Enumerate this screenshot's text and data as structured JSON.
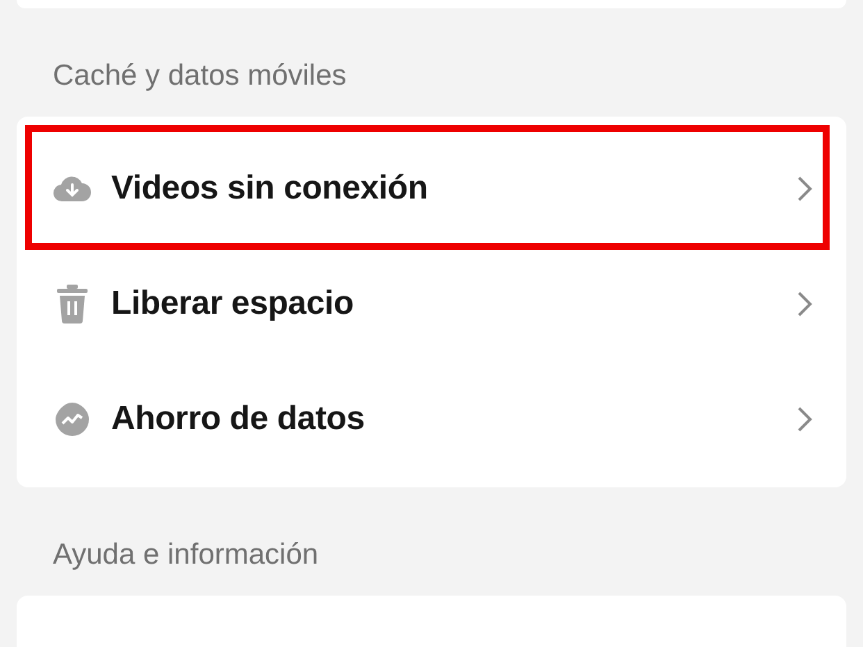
{
  "sections": [
    {
      "header": "Caché y datos móviles",
      "items": [
        {
          "kind": "download",
          "label": "Videos sin conexión",
          "highlighted": true
        },
        {
          "kind": "delete",
          "label": "Liberar espacio",
          "highlighted": false
        },
        {
          "kind": "saver",
          "label": "Ahorro de datos",
          "highlighted": false
        }
      ]
    },
    {
      "header": "Ayuda e información"
    }
  ]
}
